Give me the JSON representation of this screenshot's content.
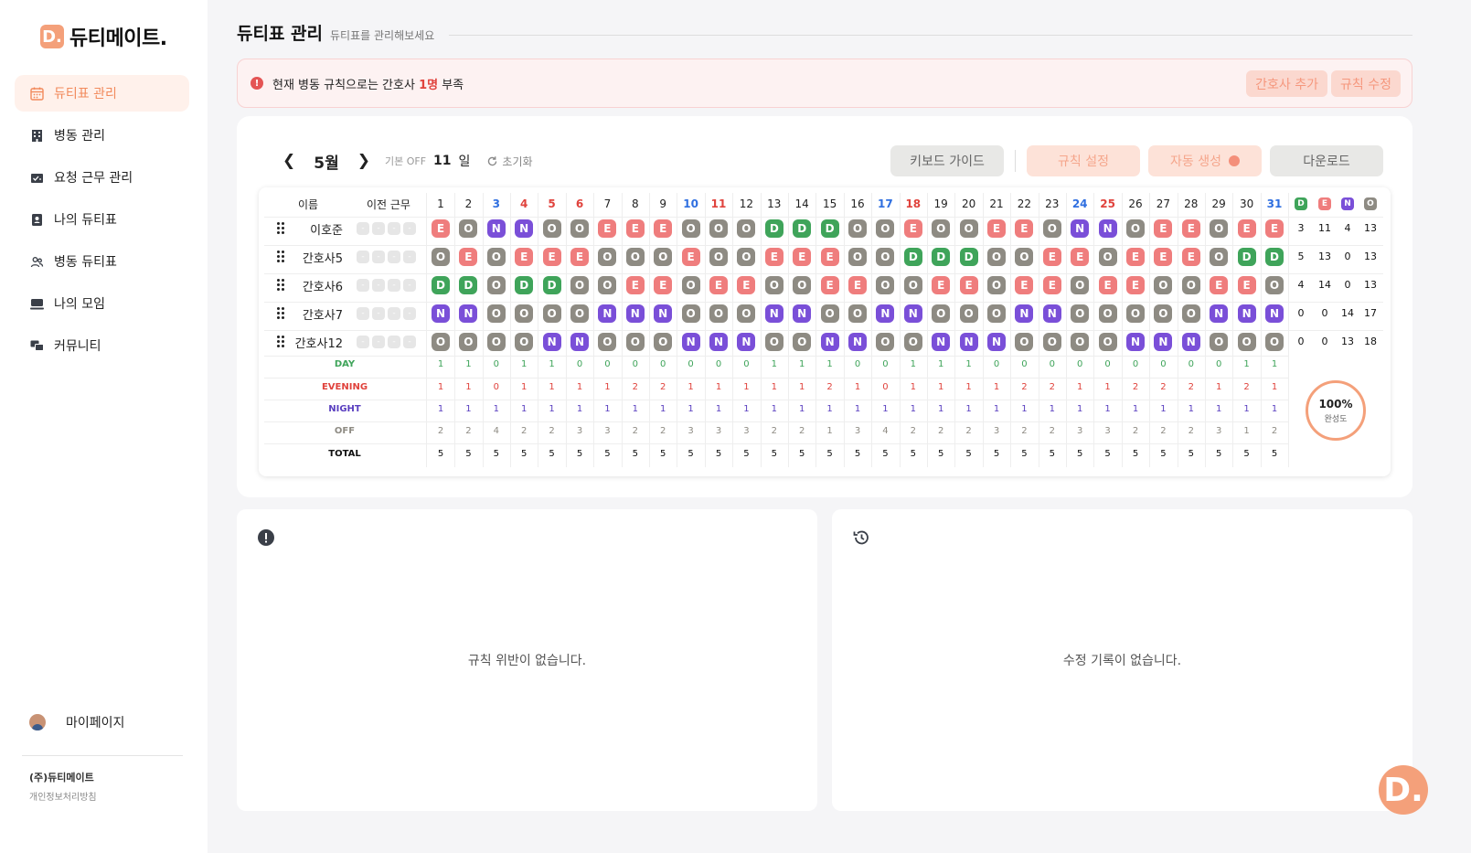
{
  "sidebar": {
    "logo": "D.",
    "brand": "듀티메이트.",
    "items": [
      {
        "label": "듀티표 관리",
        "icon": "calendar-icon",
        "active": true
      },
      {
        "label": "병동 관리",
        "icon": "building-icon",
        "active": false
      },
      {
        "label": "요청 근무 관리",
        "icon": "request-card-icon",
        "active": false
      },
      {
        "label": "나의 듀티표",
        "icon": "person-badge-icon",
        "active": false
      },
      {
        "label": "병동 듀티표",
        "icon": "people-icon",
        "active": false
      },
      {
        "label": "나의 모임",
        "icon": "group-icon",
        "active": false
      },
      {
        "label": "커뮤니티",
        "icon": "chat-icon",
        "active": false
      }
    ],
    "mypage": "마이페이지",
    "company": "(주)듀티메이트",
    "privacy": "개인정보처리방침"
  },
  "header": {
    "title": "듀티표 관리",
    "subtitle": "듀티표를 관리해보세요"
  },
  "alert": {
    "prefix": "현재 병동 규칙으로는 간호사",
    "highlight": "1명",
    "suffix": "부족",
    "add_nurse": "간호사 추가",
    "edit_rule": "규칙 수정"
  },
  "toolbar": {
    "month": "5월",
    "off_label": "기본 OFF",
    "off_value": "11",
    "off_unit": "일",
    "reset": "초기화",
    "keyboard_guide": "키보드 가이드",
    "rule_setting": "규칙 설정",
    "auto_generate": "자동 생성",
    "download": "다운로드"
  },
  "table": {
    "name_header": "이름",
    "prev_header": "이전 근무",
    "days": [
      "1",
      "2",
      "3",
      "4",
      "5",
      "6",
      "7",
      "8",
      "9",
      "10",
      "11",
      "12",
      "13",
      "14",
      "15",
      "16",
      "17",
      "18",
      "19",
      "20",
      "21",
      "22",
      "23",
      "24",
      "25",
      "26",
      "27",
      "28",
      "29",
      "30",
      "31"
    ],
    "saturdays": [
      3,
      10,
      17,
      24,
      31
    ],
    "sundays": [
      4,
      11,
      18,
      25
    ],
    "holidays": [
      5,
      6
    ],
    "count_headers": [
      "D",
      "E",
      "N",
      "O"
    ],
    "colors": {
      "D": "#3fa45a",
      "E": "#ef7d7d",
      "N": "#7a4fd8",
      "O": "#8e8b83",
      "saturday": "#2f6fe0",
      "sunday": "#e0433d"
    },
    "nurses": [
      {
        "name": "이호준",
        "prev": [
          "-",
          "-",
          "-",
          "-"
        ],
        "shifts": "EONNOOEEEOOODDDOOEOOEEONNOEEOEE",
        "counts": [
          "3",
          "11",
          "4",
          "13"
        ]
      },
      {
        "name": "간호사5",
        "prev": [
          "-",
          "-",
          "-",
          "-"
        ],
        "shifts": "OEOEEEOOOEOOEEEOODDDOOEEOEEEODD",
        "counts": [
          "5",
          "13",
          "0",
          "13"
        ]
      },
      {
        "name": "간호사6",
        "prev": [
          "-",
          "-",
          "-",
          "-"
        ],
        "shifts": "DDODDOOEEOEEOOEEOOEEOEEOEEOOEEO",
        "counts": [
          "4",
          "14",
          "0",
          "13"
        ]
      },
      {
        "name": "간호사7",
        "prev": [
          "-",
          "-",
          "-",
          "-"
        ],
        "shifts": "NNOOOONNNOOONNOONNOOONNOOOOONNN",
        "counts": [
          "0",
          "0",
          "14",
          "17"
        ]
      },
      {
        "name": "간호사12",
        "prev": [
          "-",
          "-",
          "-",
          "-"
        ],
        "shifts": "OOOONNOOONNNOONNOONNNOOOONNNOOO",
        "counts": [
          "0",
          "0",
          "13",
          "18"
        ]
      }
    ],
    "summary": [
      {
        "label": "DAY",
        "values": [
          "1",
          "1",
          "0",
          "1",
          "1",
          "0",
          "0",
          "0",
          "0",
          "0",
          "0",
          "0",
          "1",
          "1",
          "1",
          "0",
          "0",
          "1",
          "1",
          "1",
          "0",
          "0",
          "0",
          "0",
          "0",
          "0",
          "0",
          "0",
          "0",
          "1",
          "1"
        ]
      },
      {
        "label": "EVENING",
        "values": [
          "1",
          "1",
          "0",
          "1",
          "1",
          "1",
          "1",
          "2",
          "2",
          "1",
          "1",
          "1",
          "1",
          "1",
          "2",
          "1",
          "0",
          "1",
          "1",
          "1",
          "1",
          "2",
          "2",
          "1",
          "1",
          "2",
          "2",
          "2",
          "1",
          "2",
          "1"
        ]
      },
      {
        "label": "NIGHT",
        "values": [
          "1",
          "1",
          "1",
          "1",
          "1",
          "1",
          "1",
          "1",
          "1",
          "1",
          "1",
          "1",
          "1",
          "1",
          "1",
          "1",
          "1",
          "1",
          "1",
          "1",
          "1",
          "1",
          "1",
          "1",
          "1",
          "1",
          "1",
          "1",
          "1",
          "1",
          "1"
        ]
      },
      {
        "label": "OFF",
        "values": [
          "2",
          "2",
          "4",
          "2",
          "2",
          "3",
          "3",
          "2",
          "2",
          "3",
          "3",
          "3",
          "2",
          "2",
          "1",
          "3",
          "4",
          "2",
          "2",
          "2",
          "3",
          "2",
          "2",
          "3",
          "3",
          "2",
          "2",
          "2",
          "3",
          "1",
          "2"
        ]
      },
      {
        "label": "TOTAL",
        "values": [
          "5",
          "5",
          "5",
          "5",
          "5",
          "5",
          "5",
          "5",
          "5",
          "5",
          "5",
          "5",
          "5",
          "5",
          "5",
          "5",
          "5",
          "5",
          "5",
          "5",
          "5",
          "5",
          "5",
          "5",
          "5",
          "5",
          "5",
          "5",
          "5",
          "5",
          "5"
        ]
      }
    ],
    "summary_colors": {
      "DAY": "#3fa45a",
      "EVENING": "#e0433d",
      "NIGHT": "#5a3fc0",
      "OFF": "#8e8b83",
      "TOTAL": "#111111"
    },
    "completion_percent": "100%",
    "completion_label": "완성도"
  },
  "panels": {
    "violations_message": "규칙 위반이 없습니다.",
    "history_message": "수정 기록이 없습니다."
  },
  "fab": "D."
}
